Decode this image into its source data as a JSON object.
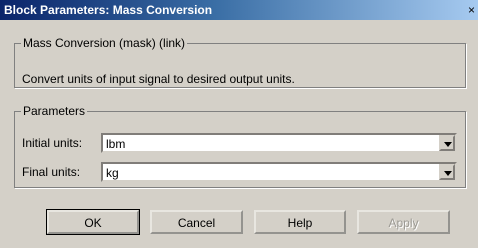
{
  "window": {
    "title": "Block Parameters: Mass Conversion",
    "close_glyph": "×"
  },
  "mask_group": {
    "legend": "Mass Conversion (mask) (link)",
    "description": "Convert units of input signal to desired output units."
  },
  "parameters": {
    "legend": "Parameters",
    "initial_units": {
      "label": "Initial units:",
      "value": "lbm"
    },
    "final_units": {
      "label": "Final units:",
      "value": "kg"
    }
  },
  "buttons": {
    "ok": "OK",
    "cancel": "Cancel",
    "help": "Help",
    "apply": "Apply"
  },
  "colors": {
    "titlebar_start": "#0a246a",
    "titlebar_end": "#a6caf0",
    "face": "#d4d0c8"
  }
}
